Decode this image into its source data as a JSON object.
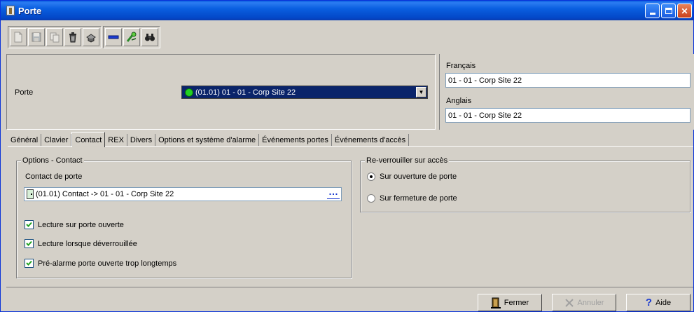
{
  "window": {
    "title": "Porte"
  },
  "toolbar": {
    "buttons": [
      {
        "icon": "new-icon",
        "enabled": false
      },
      {
        "icon": "save-icon",
        "enabled": false
      },
      {
        "icon": "copy-icon",
        "enabled": false
      },
      {
        "icon": "delete-icon",
        "enabled": true
      },
      {
        "icon": "print-icon",
        "enabled": true
      },
      {
        "icon": "minus-icon",
        "enabled": true
      },
      {
        "icon": "link-icon",
        "enabled": true
      },
      {
        "icon": "binoculars-icon",
        "enabled": true
      }
    ]
  },
  "header": {
    "porte_label": "Porte",
    "porte_value": "(01.01) 01 - 01 - Corp Site 22"
  },
  "languages": {
    "francais_label": "Français",
    "francais_value": "01 - 01 - Corp Site 22",
    "anglais_label": "Anglais",
    "anglais_value": "01 - 01 - Corp Site 22"
  },
  "tabs": [
    {
      "label": "Général",
      "active": false
    },
    {
      "label": "Clavier",
      "active": false
    },
    {
      "label": "Contact",
      "active": true
    },
    {
      "label": "REX",
      "active": false
    },
    {
      "label": "Divers",
      "active": false
    },
    {
      "label": "Options et système d'alarme",
      "active": false
    },
    {
      "label": "Événements portes",
      "active": false
    },
    {
      "label": "Événements d'accès",
      "active": false
    }
  ],
  "options_contact": {
    "title": "Options - Contact",
    "contact_label": "Contact de porte",
    "contact_value": "(01.01) Contact -> 01 - 01 - Corp Site 22",
    "checkboxes": [
      {
        "label": "Lecture sur porte ouverte",
        "checked": true
      },
      {
        "label": "Lecture lorsque déverrouillée",
        "checked": true
      },
      {
        "label": "Pré-alarme porte ouverte trop longtemps",
        "checked": true
      }
    ]
  },
  "reverrouiller": {
    "title": "Re-verrouiller sur accès",
    "options": [
      {
        "label": "Sur ouverture de porte",
        "selected": true
      },
      {
        "label": "Sur fermeture de porte",
        "selected": false
      }
    ]
  },
  "footer": {
    "fermer": "Fermer",
    "annuler": "Annuler",
    "aide": "Aide"
  }
}
